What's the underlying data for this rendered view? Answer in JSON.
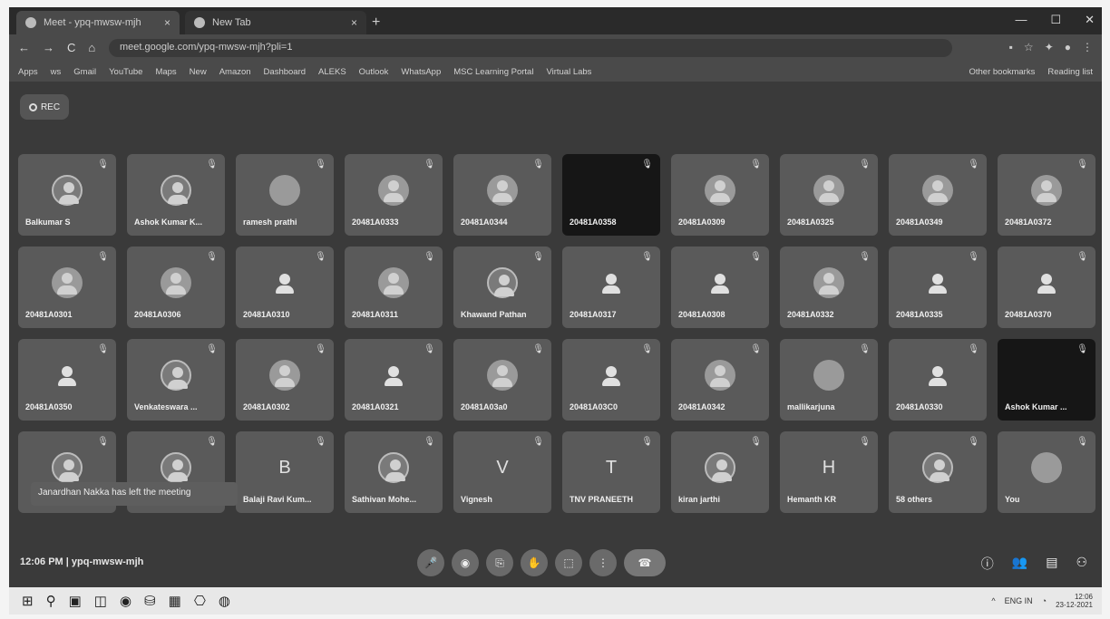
{
  "browser": {
    "tabs": [
      {
        "label": "Meet - ypq-mwsw-mjh",
        "close": "×"
      },
      {
        "label": "New Tab",
        "close": "×"
      }
    ],
    "new_tab": "+",
    "window_controls": [
      "—",
      "☐",
      "✕"
    ],
    "nav": [
      "←",
      "→",
      "C",
      "⌂"
    ],
    "url": "meet.google.com/ypq-mwsw-mjh?pli=1",
    "bookmarks": [
      "Apps",
      "ws",
      "Gmail",
      "YouTube",
      "Maps",
      "New",
      "Amazon",
      "Dashboard",
      "ALEKS",
      "Outlook",
      "WhatsApp",
      "MSC Learning Portal",
      "Virtual Labs",
      "Other bookmarks",
      "Reading list"
    ]
  },
  "meeting": {
    "rec_label": "REC",
    "tiles": [
      {
        "name": "Balkumar S",
        "avatar": "photo"
      },
      {
        "name": "Ashok Kumar K...",
        "avatar": "photo"
      },
      {
        "name": "ramesh prathi",
        "avatar": "circle"
      },
      {
        "name": "20481A0333",
        "avatar": "person"
      },
      {
        "name": "20481A0344",
        "avatar": "person"
      },
      {
        "name": "20481A0358",
        "avatar": "dark"
      },
      {
        "name": "20481A0309",
        "avatar": "person"
      },
      {
        "name": "20481A0325",
        "avatar": "person"
      },
      {
        "name": "20481A0349",
        "avatar": "person"
      },
      {
        "name": "20481A0372",
        "avatar": "person"
      },
      {
        "name": "20481A0301",
        "avatar": "person"
      },
      {
        "name": "20481A0306",
        "avatar": "person"
      },
      {
        "name": "20481A0310",
        "avatar": "small"
      },
      {
        "name": "20481A0311",
        "avatar": "person"
      },
      {
        "name": "Khawand Pathan",
        "avatar": "photo"
      },
      {
        "name": "20481A0317",
        "avatar": "small"
      },
      {
        "name": "20481A0308",
        "avatar": "small"
      },
      {
        "name": "20481A0332",
        "avatar": "person"
      },
      {
        "name": "20481A0335",
        "avatar": "small"
      },
      {
        "name": "20481A0370",
        "avatar": "small"
      },
      {
        "name": "20481A0350",
        "avatar": "small"
      },
      {
        "name": "Venkateswara ...",
        "avatar": "photo"
      },
      {
        "name": "20481A0302",
        "avatar": "person"
      },
      {
        "name": "20481A0321",
        "avatar": "small"
      },
      {
        "name": "20481A03a0",
        "avatar": "person"
      },
      {
        "name": "20481A03C0",
        "avatar": "small"
      },
      {
        "name": "20481A0342",
        "avatar": "person"
      },
      {
        "name": "mallikarjuna",
        "avatar": "circle"
      },
      {
        "name": "20481A0330",
        "avatar": "small"
      },
      {
        "name": "Ashok Kumar ...",
        "avatar": "dark"
      },
      {
        "name": "",
        "avatar": "photo"
      },
      {
        "name": "",
        "avatar": "photo"
      },
      {
        "name": "Balaji Ravi Kum...",
        "avatar": "letter",
        "letter": "B"
      },
      {
        "name": "Sathivan Mohe...",
        "avatar": "photo"
      },
      {
        "name": "Vignesh",
        "avatar": "letter",
        "letter": "V"
      },
      {
        "name": "TNV PRANEETH",
        "avatar": "letter",
        "letter": "T"
      },
      {
        "name": "kiran jarthi",
        "avatar": "photo"
      },
      {
        "name": "Hemanth KR",
        "avatar": "letter",
        "letter": "H"
      },
      {
        "name": "58 others",
        "avatar": "photo"
      },
      {
        "name": "You",
        "avatar": "circle"
      }
    ],
    "toast": "Janardhan Nakka has left the meeting",
    "clock": "12:06 PM",
    "meeting_code": "ypq-mwsw-mjh",
    "controls": [
      "🎤",
      "◉",
      "⎘",
      "✋",
      "⬚",
      "⋮",
      "☎"
    ],
    "right_controls": [
      "ⓘ",
      "👥",
      "▤",
      "⚇"
    ]
  },
  "taskbar": {
    "icons": [
      "⊞",
      "⚲",
      "▣",
      "◫",
      "◉",
      "⛁",
      "▦",
      "⎔",
      "◍"
    ],
    "tray": "ENG IN",
    "time": "12:06",
    "date": "23-12-2021"
  }
}
